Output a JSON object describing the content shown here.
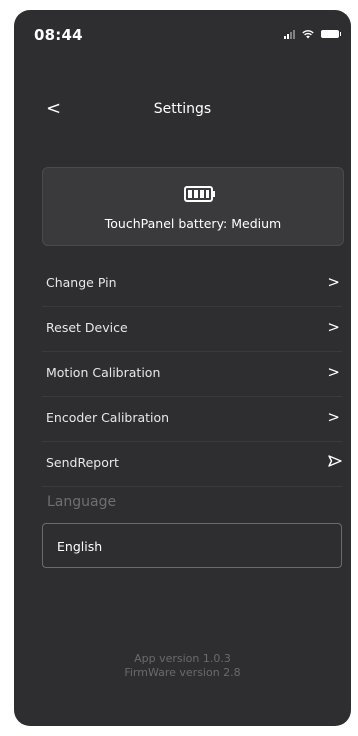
{
  "status_bar": {
    "time": "08:44"
  },
  "header": {
    "back_label": "<",
    "title": "Settings"
  },
  "battery": {
    "prefix": "TouchPanel battery:",
    "level": "Medium"
  },
  "menu": {
    "items": [
      {
        "label": "Change Pin",
        "icon": "chevron-right-icon"
      },
      {
        "label": "Reset Device",
        "icon": "chevron-right-icon"
      },
      {
        "label": "Motion Calibration",
        "icon": "chevron-right-icon"
      },
      {
        "label": "Encoder Calibration",
        "icon": "chevron-right-icon"
      },
      {
        "label": "SendReport",
        "icon": "send-icon"
      }
    ]
  },
  "language": {
    "label": "Language",
    "selected": "English"
  },
  "footer": {
    "app_version": "App version 1.0.3",
    "firmware_version": "FirmWare version 2.8"
  },
  "colors": {
    "background": "#2e2e30",
    "card": "#3a3a3c",
    "muted_text": "#6a6a6c"
  }
}
